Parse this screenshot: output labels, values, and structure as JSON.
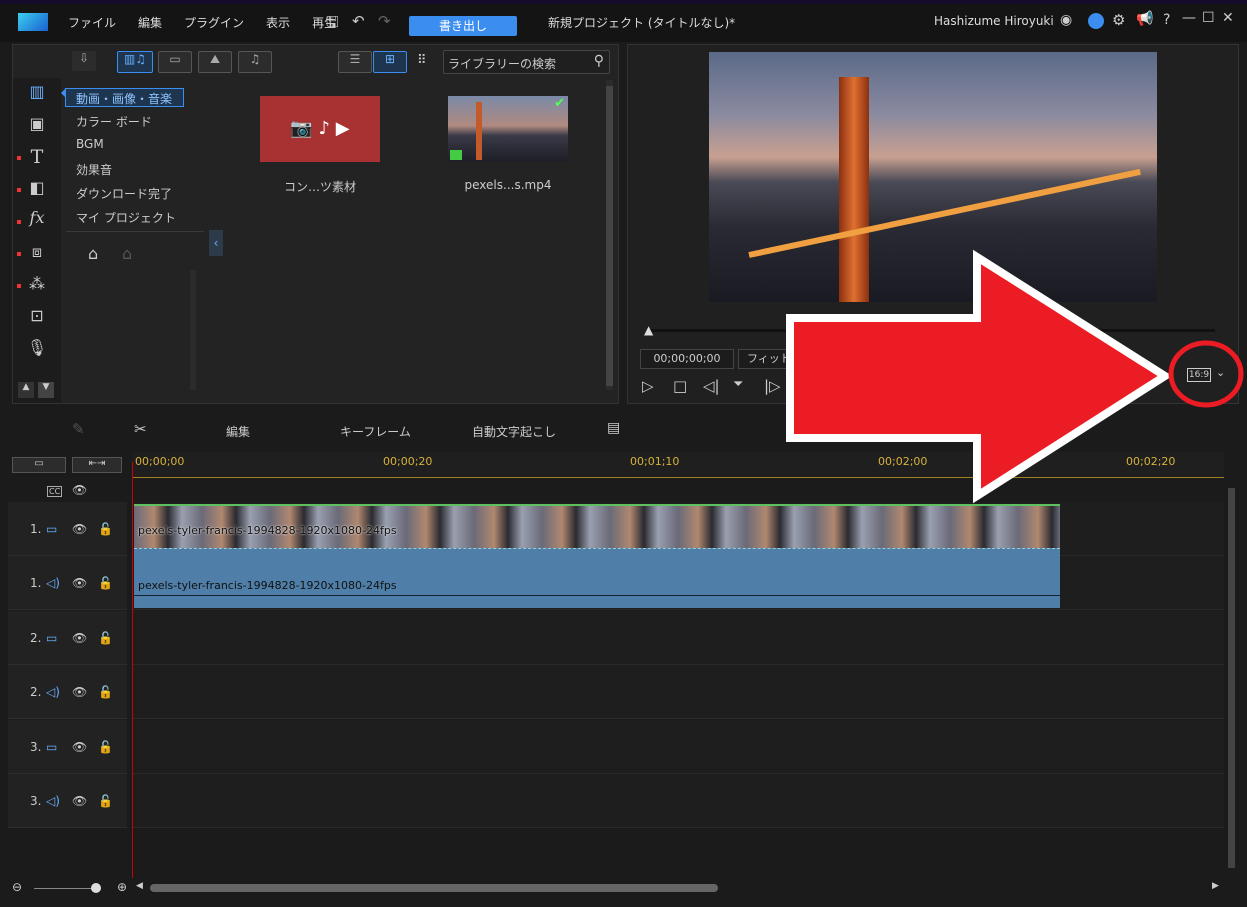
{
  "menu": {
    "items": [
      "ファイル",
      "編集",
      "プラグイン",
      "表示",
      "再生"
    ],
    "export": "書き出し",
    "project_title": "新規プロジェクト (タイトルなし)*",
    "user": "Hashizume Hiroyuki"
  },
  "library": {
    "search_placeholder": "ライブラリーの検索",
    "categories": [
      "動画・画像・音楽",
      "カラー ボード",
      "BGM",
      "効果音",
      "ダウンロード完了",
      "マイ プロジェクト"
    ],
    "items": [
      {
        "label": "コン…ツ素材"
      },
      {
        "label": "pexels...s.mp4"
      }
    ]
  },
  "preview": {
    "timecode": "00;00;00;00",
    "zoom": "フィット",
    "aspect": "16:9"
  },
  "toolbar": {
    "edit": "編集",
    "keyframe": "キーフレーム",
    "transcribe": "自動文字起こし"
  },
  "timeline": {
    "ticks": [
      "00;00;00",
      "00;00;20",
      "00;01;10",
      "00;02;00",
      "00;02;20"
    ],
    "tracks": [
      {
        "label": "1.",
        "type": "video"
      },
      {
        "label": "1.",
        "type": "audio"
      },
      {
        "label": "2.",
        "type": "video"
      },
      {
        "label": "2.",
        "type": "audio"
      },
      {
        "label": "3.",
        "type": "video"
      },
      {
        "label": "3.",
        "type": "audio"
      }
    ],
    "clip_name": "pexels-tyler-francis-1994828-1920x1080-24fps"
  },
  "colors": {
    "accent": "#3b8ef0",
    "annotation": "#ec1c24"
  }
}
